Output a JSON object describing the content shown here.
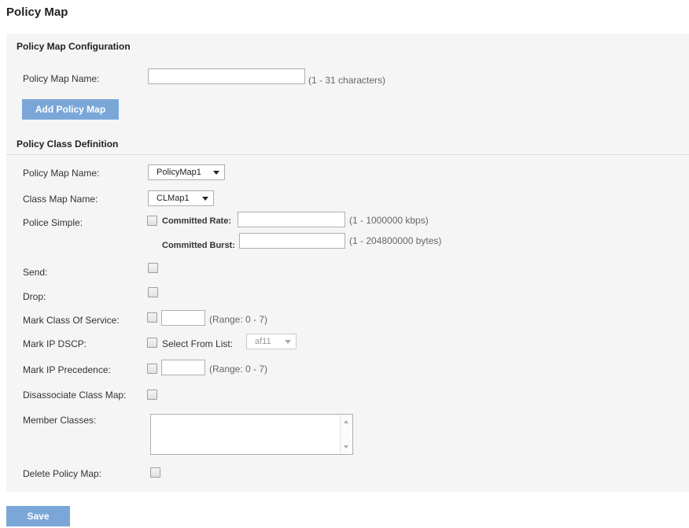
{
  "page": {
    "title": "Policy Map"
  },
  "config": {
    "section_title": "Policy Map Configuration",
    "name_label": "Policy Map Name:",
    "name_value": "",
    "name_hint": "(1 - 31 characters)",
    "add_button": "Add Policy Map"
  },
  "definition": {
    "section_title": "Policy Class Definition",
    "policy_map_name_label": "Policy Map Name:",
    "policy_map_selected": "PolicyMap1",
    "class_map_name_label": "Class Map Name:",
    "class_map_selected": "CLMap1",
    "police_simple_label": "Police Simple:",
    "committed_rate_label": "Committed Rate:",
    "committed_rate_hint": "(1 - 1000000 kbps)",
    "committed_burst_label": "Committed Burst:",
    "committed_burst_hint": "(1 - 204800000 bytes)",
    "send_label": "Send:",
    "drop_label": "Drop:",
    "mark_cos_label": "Mark Class Of Service:",
    "mark_cos_hint": "(Range: 0 - 7)",
    "mark_dscp_label": "Mark IP DSCP:",
    "select_from_list_label": "Select From List:",
    "dscp_selected": "af11",
    "mark_precedence_label": "Mark IP Precedence:",
    "mark_precedence_hint": "(Range: 0 - 7)",
    "disassociate_label": "Disassociate Class Map:",
    "member_classes_label": "Member Classes:",
    "delete_label": "Delete Policy Map:"
  },
  "footer": {
    "save_button": "Save"
  },
  "colors": {
    "button": "#7aa7d8",
    "panel": "#f5f5f5"
  }
}
